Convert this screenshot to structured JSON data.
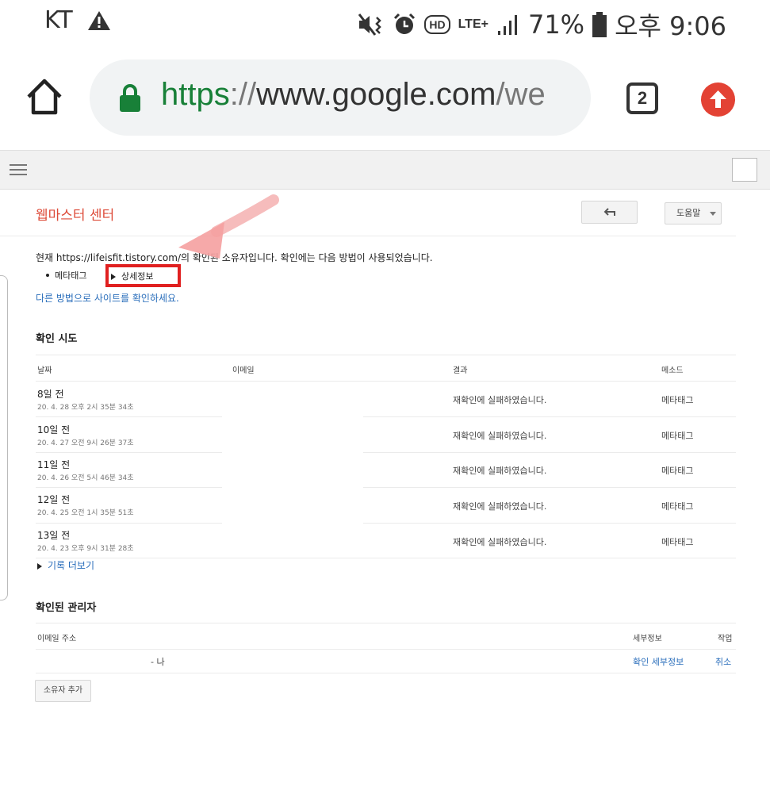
{
  "status_bar": {
    "carrier": "KT",
    "alert_icon": "warning-triangle-icon",
    "battery_pct": "71%",
    "time": "오후 9:06",
    "icons": [
      "mute-vibrate-icon",
      "alarm-icon",
      "hd-voice-icon",
      "lte-plus-icon",
      "signal-icon",
      "battery-icon"
    ],
    "hd_label": "HD",
    "lte_label": "LTE+"
  },
  "browser": {
    "url_scheme": "https",
    "url_sep": "://",
    "url_host": "www.google.com",
    "url_path": "/we",
    "tab_count": "2"
  },
  "header": {
    "title": "웹마스터 센터",
    "help_label": "도움말"
  },
  "ownership": {
    "text": "현재 https://lifeisfit.tistory.com/의 확인된 소유자입니다. 확인에는 다음 방법이 사용되었습니다.",
    "method": "메타태그",
    "details_link": "상세정보",
    "other_method_link": "다른 방법으로 사이트를 확인하세요."
  },
  "attempts": {
    "title": "확인 시도",
    "columns": [
      "날짜",
      "이메일",
      "결과",
      "메소드"
    ],
    "rows": [
      {
        "relative": "8일 전",
        "timestamp": "20. 4. 28 오후 2시 35분 34초",
        "result": "재확인에 실패하였습니다.",
        "method": "메타태그"
      },
      {
        "relative": "10일 전",
        "timestamp": "20. 4. 27 오전 9시 26분 37초",
        "result": "재확인에 실패하였습니다.",
        "method": "메타태그"
      },
      {
        "relative": "11일 전",
        "timestamp": "20. 4. 26 오전 5시 46분 34초",
        "result": "재확인에 실패하였습니다.",
        "method": "메타태그"
      },
      {
        "relative": "12일 전",
        "timestamp": "20. 4. 25 오전 1시 35분 51초",
        "result": "재확인에 실패하였습니다.",
        "method": "메타태그"
      },
      {
        "relative": "13일 전",
        "timestamp": "20. 4. 23 오후 9시 31분 28초",
        "result": "재확인에 실패하였습니다.",
        "method": "메타태그"
      }
    ],
    "more_link": "기록 더보기"
  },
  "owners": {
    "title": "확인된 관리자",
    "columns": [
      "이메일 주소",
      "세부정보",
      "작업"
    ],
    "rows": [
      {
        "email": "- 나",
        "details_link": "확인 세부정보",
        "action_link": "취소"
      }
    ],
    "add_button": "소유자 추가"
  },
  "colors": {
    "title_red": "#dd4b39",
    "link_blue": "#2a6ebb",
    "highlight_red": "#e02020",
    "secure_green": "#188038",
    "update_red": "#e34234"
  }
}
